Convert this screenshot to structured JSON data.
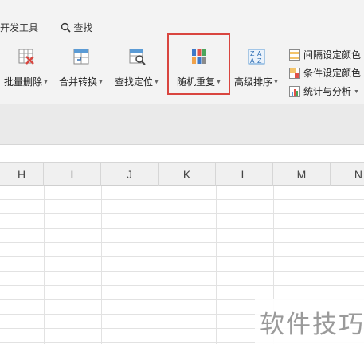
{
  "menu": {
    "dev_tools": "开发工具",
    "find": "查找"
  },
  "ribbon": {
    "batch_delete": "批量删除",
    "merge_convert": "合并转换",
    "find_locate": "查找定位",
    "random_repeat": "随机重复",
    "advanced_sort": "高级排序",
    "interval_color": "间隔设定颜色",
    "condition_color": "条件设定颜色",
    "stats_analysis": "统计与分析"
  },
  "columns": [
    "H",
    "I",
    "J",
    "K",
    "L",
    "M",
    "N"
  ],
  "watermark": "软件技巧",
  "colors": {
    "highlight_border": "#d9453f",
    "ribbon_bg": "#f3f3f3",
    "header_bg": "#f0f0f0"
  },
  "icons": {
    "batch_delete": "table-delete-icon",
    "merge_convert": "merge-icon",
    "find_locate": "table-search-icon",
    "random_repeat": "color-blocks-icon",
    "advanced_sort": "sort-az-icon"
  }
}
